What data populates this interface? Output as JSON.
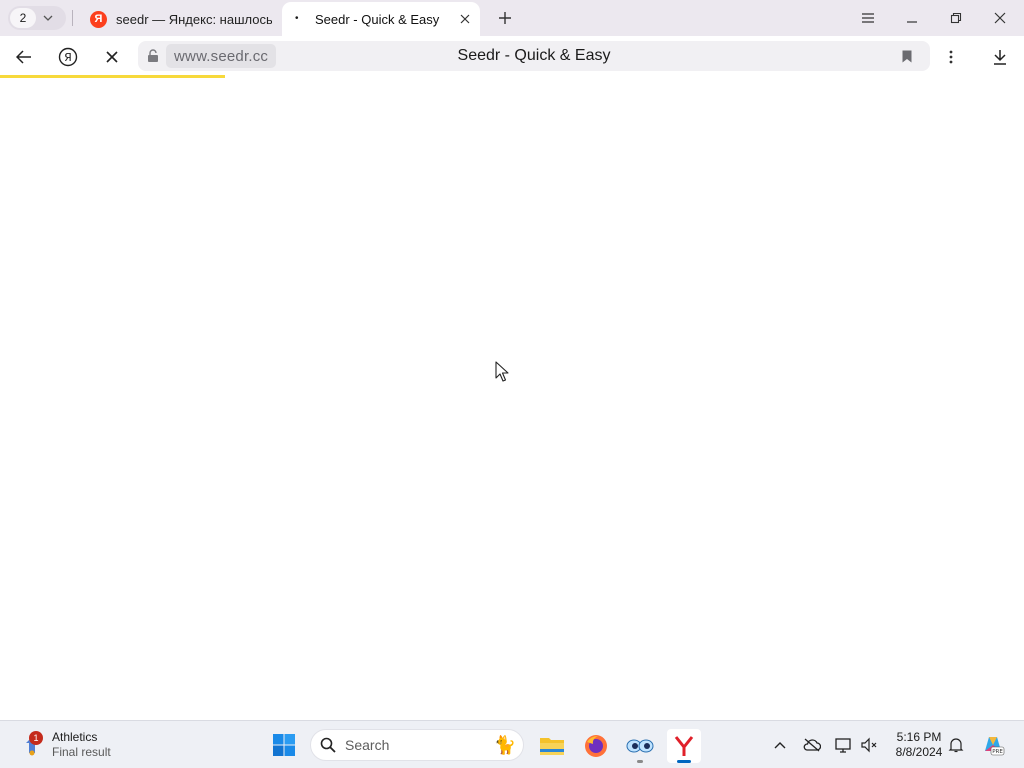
{
  "browser": {
    "tab_count": "2",
    "tabs": [
      {
        "title": "seedr — Яндекс: нашлось",
        "favicon_letter": "Я",
        "favicon_color": "#fc3f1d",
        "active": false
      },
      {
        "title": "Seedr - Quick & Easy",
        "favicon_letter": "•",
        "active": true
      }
    ],
    "address_bar": {
      "url": "www.seedr.cc",
      "page_title": "Seedr - Quick & Easy",
      "secure_icon": "lock-icon"
    },
    "loading_progress": 0.22,
    "progress_color": "#f7d93b"
  },
  "taskbar": {
    "widget": {
      "badge": "1",
      "title": "Athletics",
      "subtitle": "Final result"
    },
    "search_placeholder": "Search",
    "apps": [
      "file-explorer-icon",
      "firefox-icon",
      "eyes-app-icon",
      "yandex-browser-icon"
    ],
    "clock": {
      "time": "5:16 PM",
      "date": "8/8/2024"
    }
  }
}
